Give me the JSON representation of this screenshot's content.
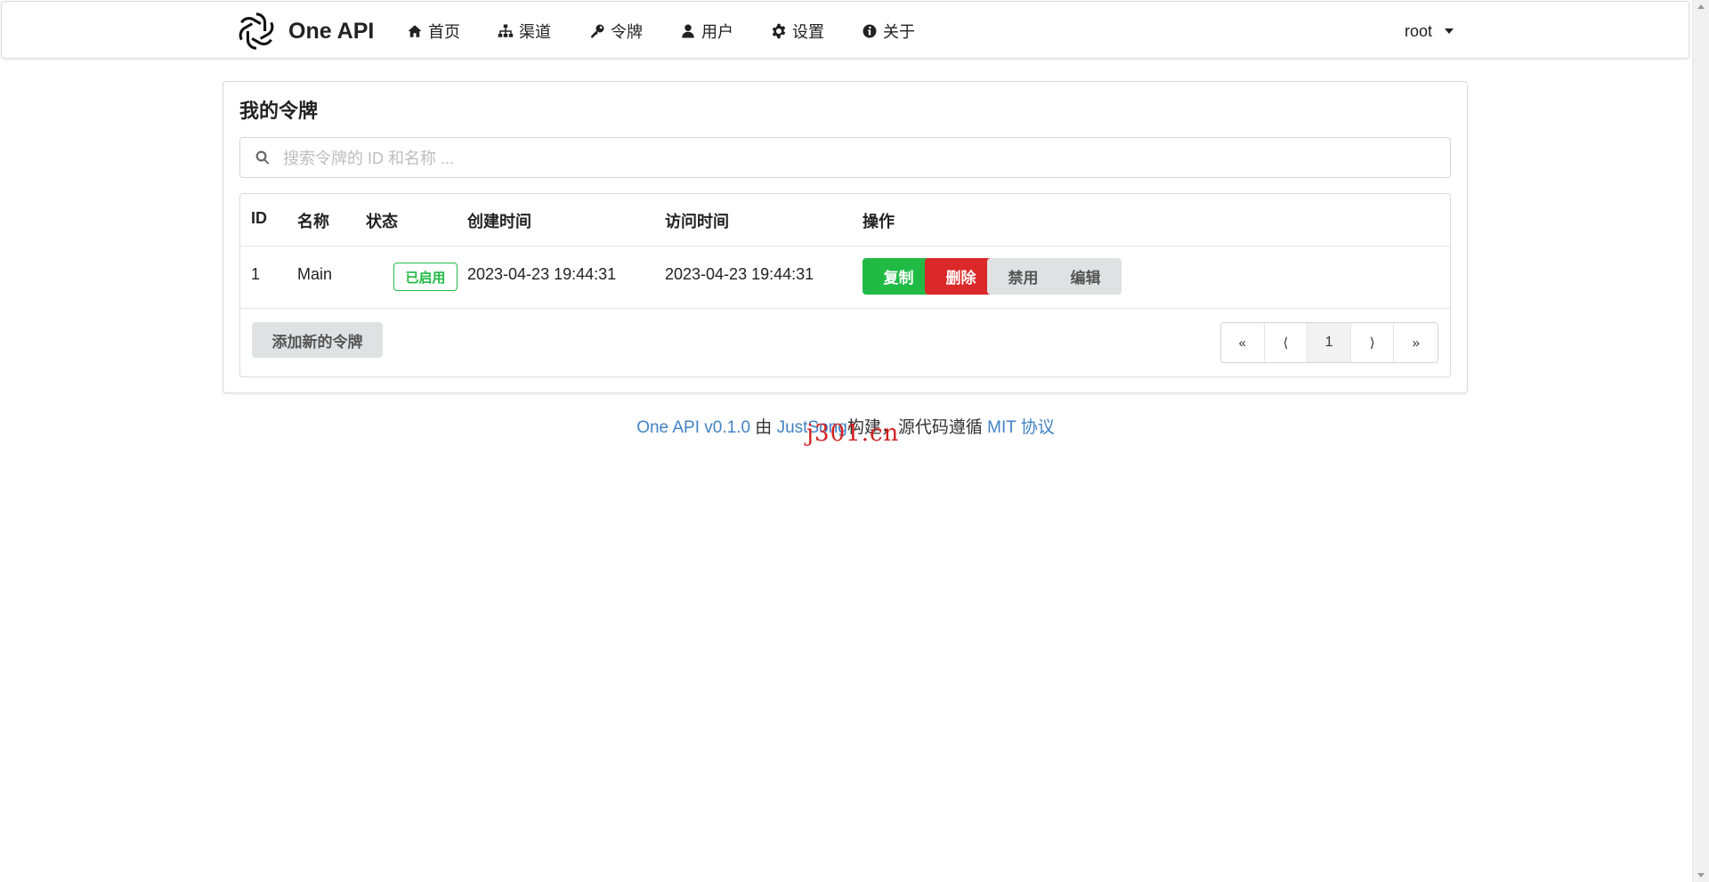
{
  "navbar": {
    "brand": "One API",
    "items": [
      {
        "label": "首页",
        "icon": "home-icon"
      },
      {
        "label": "渠道",
        "icon": "sitemap-icon"
      },
      {
        "label": "令牌",
        "icon": "key-icon"
      },
      {
        "label": "用户",
        "icon": "user-icon"
      },
      {
        "label": "设置",
        "icon": "gear-icon"
      },
      {
        "label": "关于",
        "icon": "info-icon"
      }
    ],
    "user": "root"
  },
  "page": {
    "title": "我的令牌",
    "search_placeholder": "搜索令牌的 ID 和名称 ..."
  },
  "table": {
    "headers": [
      "ID",
      "名称",
      "状态",
      "创建时间",
      "访问时间",
      "操作"
    ],
    "rows": [
      {
        "id": "1",
        "name": "Main",
        "status": "已启用",
        "created": "2023-04-23 19:44:31",
        "accessed": "2023-04-23 19:44:31",
        "actions": [
          "复制",
          "删除",
          "禁用",
          "编辑"
        ]
      }
    ],
    "add_button": "添加新的令牌"
  },
  "pagination": {
    "first": "«",
    "prev": "⟨",
    "current": "1",
    "next": "⟩",
    "last": "»"
  },
  "footer": {
    "project_link": "One API v0.1.0",
    "by": "由",
    "author_link": "JustSong",
    "built": "构建，源代码遵循",
    "license_link": "MIT 协议"
  },
  "watermark": "j301.cn",
  "colors": {
    "accent_green": "#21ba45",
    "danger_red": "#db2828",
    "link_blue": "#4183c4"
  }
}
